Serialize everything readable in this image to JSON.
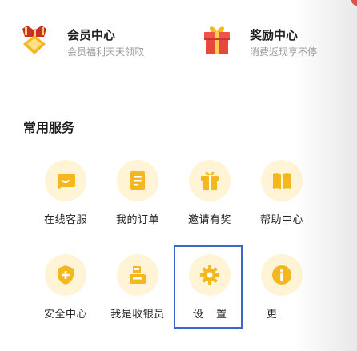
{
  "promos": {
    "vip": {
      "title": "会员中心",
      "subtitle": "会员福利天天领取",
      "icon": "vip-crown-icon"
    },
    "reward": {
      "title": "奖励中心",
      "subtitle": "消费返现享不停",
      "icon": "gift-box-icon"
    }
  },
  "services": {
    "title": "常用服务",
    "items": [
      {
        "label": "在线客服",
        "icon": "chat-icon"
      },
      {
        "label": "我的订单",
        "icon": "order-icon"
      },
      {
        "label": "邀请有奖",
        "icon": "gift-icon"
      },
      {
        "label": "帮助中心",
        "icon": "book-icon"
      },
      {
        "label": "安全中心",
        "icon": "shield-icon"
      },
      {
        "label": "我是收银员",
        "icon": "cashier-icon"
      },
      {
        "label": "设 置",
        "icon": "gear-icon"
      },
      {
        "label": "更",
        "icon": "info-icon"
      }
    ]
  },
  "colors": {
    "icon_bg": "#fff4d6",
    "icon_fg": "#f5b71f",
    "highlight_border": "#3d66c8",
    "reward_red": "#e9463d"
  }
}
